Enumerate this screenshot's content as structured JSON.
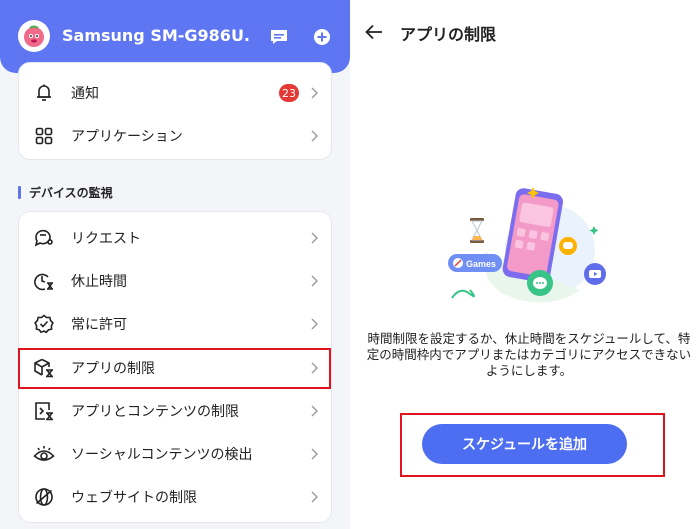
{
  "left_panel": {
    "header": {
      "device_name": "Samsung SM-G986U."
    },
    "top_card": {
      "items": [
        {
          "label": "通知",
          "badge": "23"
        },
        {
          "label": "アプリケーション"
        }
      ]
    },
    "section": {
      "title": "デバイスの監視"
    },
    "monitor_card": {
      "items": [
        {
          "label": "リクエスト"
        },
        {
          "label": "休止時間"
        },
        {
          "label": "常に許可"
        },
        {
          "label": "アプリの制限"
        },
        {
          "label": "アプリとコンテンツの制限"
        },
        {
          "label": "ソーシャルコンテンツの検出"
        },
        {
          "label": "ウェブサイトの制限"
        }
      ]
    }
  },
  "right_panel": {
    "title": "アプリの制限",
    "illustration": {
      "games_label": "Games"
    },
    "description": "時間制限を設定するか、休止時間をスケジュールして、特定の時間枠内でアプリまたはカテゴリにアクセスできないようにします。",
    "schedule_button": "スケジュールを追加"
  },
  "colors": {
    "accent": "#5e76f2",
    "button": "#4d6ef0",
    "badge": "#e53935",
    "highlight": "#e0141e"
  }
}
